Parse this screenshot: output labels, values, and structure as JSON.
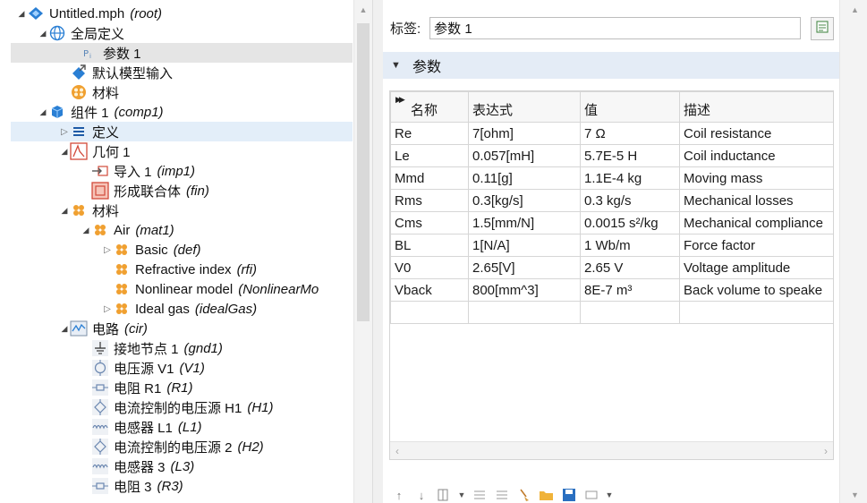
{
  "tree": {
    "root": {
      "label": "Untitled.mph",
      "tag": "(root)"
    },
    "global_defs": {
      "label": "全局定义"
    },
    "param1": {
      "label": "参数 1"
    },
    "default_model_inputs": {
      "label": "默认模型输入"
    },
    "global_materials": {
      "label": "材料"
    },
    "component1": {
      "label": "组件 1",
      "tag": "(comp1)"
    },
    "definitions": {
      "label": "定义"
    },
    "geometry1": {
      "label": "几何 1"
    },
    "import1": {
      "label": "导入 1",
      "tag": "(imp1)"
    },
    "form_union": {
      "label": "形成联合体",
      "tag": "(fin)"
    },
    "materials": {
      "label": "材料"
    },
    "air": {
      "label": "Air",
      "tag": "(mat1)"
    },
    "basic": {
      "label": "Basic",
      "tag": "(def)"
    },
    "refractive": {
      "label": "Refractive index",
      "tag": "(rfi)"
    },
    "nonlinear": {
      "label": "Nonlinear model",
      "tag": "(NonlinearMo"
    },
    "ideal_gas": {
      "label": "Ideal gas",
      "tag": "(idealGas)"
    },
    "circuit": {
      "label": "电路",
      "tag": "(cir)"
    },
    "ground": {
      "label": "接地节点 1",
      "tag": "(gnd1)"
    },
    "vsource": {
      "label": "电压源 V1",
      "tag": "(V1)"
    },
    "r1": {
      "label": "电阻 R1",
      "tag": "(R1)"
    },
    "h1": {
      "label": "电流控制的电压源 H1",
      "tag": "(H1)"
    },
    "l1": {
      "label": "电感器 L1",
      "tag": "(L1)"
    },
    "h2": {
      "label": "电流控制的电压源 2",
      "tag": "(H2)"
    },
    "l3": {
      "label": "电感器 3",
      "tag": "(L3)"
    },
    "r3": {
      "label": "电阻 3",
      "tag": "(R3)"
    }
  },
  "settings": {
    "label_caption": "标签:",
    "label_value": "参数 1",
    "section_title": "参数",
    "table": {
      "headers": [
        "名称",
        "表达式",
        "值",
        "描述"
      ],
      "rows": [
        [
          "Re",
          "7[ohm]",
          "7 Ω",
          "Coil resistance"
        ],
        [
          "Le",
          "0.057[mH]",
          "5.7E-5 H",
          "Coil inductance"
        ],
        [
          "Mmd",
          "0.11[g]",
          "1.1E-4 kg",
          "Moving mass"
        ],
        [
          "Rms",
          "0.3[kg/s]",
          "0.3 kg/s",
          "Mechanical losses"
        ],
        [
          "Cms",
          "1.5[mm/N]",
          "0.0015 s²/kg",
          "Mechanical compliance"
        ],
        [
          "BL",
          "1[N/A]",
          "1 Wb/m",
          "Force factor"
        ],
        [
          "V0",
          "2.65[V]",
          "2.65 V",
          "Voltage amplitude"
        ],
        [
          "Vback",
          "800[mm^3]",
          "8E-7 m³",
          "Back volume to speake"
        ],
        [
          "",
          "",
          "",
          ""
        ]
      ]
    }
  },
  "colors": {
    "selection_gray": "#e5e5e5",
    "selection_blue": "#e3eef9",
    "section_header": "#e4ecf6",
    "icon_blue": "#2a7fd4",
    "icon_orange": "#f0a030",
    "icon_red": "#d24a3a"
  }
}
